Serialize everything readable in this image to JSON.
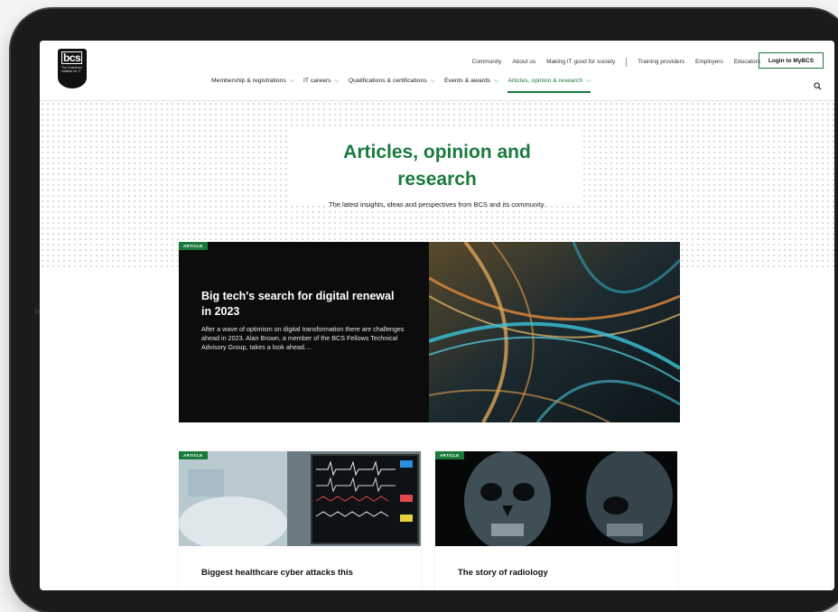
{
  "colors": {
    "accent": "#1a7a3c",
    "hero_title": "#1a7a3c",
    "device": "#1b1b1d"
  },
  "logo": {
    "mark": "bcs",
    "tagline": "The Chartered Institute for IT"
  },
  "top_nav": [
    "Community",
    "About us",
    "Making IT good for society",
    "Training providers",
    "Employers",
    "Educators"
  ],
  "login_label": "Login to MyBCS",
  "main_nav": [
    {
      "label": "Membership & registrations",
      "active": false
    },
    {
      "label": "IT careers",
      "active": false
    },
    {
      "label": "Qualifications & certifications",
      "active": false
    },
    {
      "label": "Events & awards",
      "active": false
    },
    {
      "label": "Articles, opinion & research",
      "active": true
    }
  ],
  "hero": {
    "title_line1": "Articles, opinion and",
    "title_line2": "research",
    "subtitle": "The latest insights, ideas and perspectives from BCS and its community."
  },
  "featured": {
    "badge": "ARTICLE",
    "title": "Big tech's search for digital renewal in 2023",
    "description": "After a wave of optimism on digital transformation there are challenges ahead in 2023. Alan Brown, a member of the BCS Fellows Technical Advisory Group, takes a look ahead...."
  },
  "cards": [
    {
      "badge": "ARTICLE",
      "title": "Biggest healthcare cyber attacks this"
    },
    {
      "badge": "ARTICLE",
      "title": "The story of radiology"
    }
  ],
  "icons": {
    "search": "search-icon",
    "chevron": "chevron-down-icon"
  }
}
